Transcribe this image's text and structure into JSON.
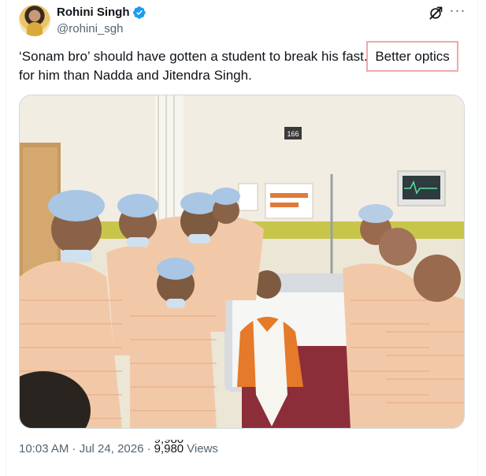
{
  "tweet": {
    "author": {
      "display_name": "Rohini Singh",
      "handle": "@rohini_sgh",
      "verified": true,
      "avatar_icon": "user-avatar"
    },
    "text_part1": "‘Sonam bro’ should have gotten a student to break his fast. ",
    "text_highlighted": "Better optics",
    "text_part2": "for him than Nadda and Jitendra Singh.",
    "highlight_color": "#f0a9a9",
    "image_room_number": "166",
    "timestamp": "10:03 AM · Jul 24, 2026 ·",
    "views_count": "9,980",
    "views_count_previous": "9,980",
    "views_label": "Views"
  },
  "icons": {
    "verified": "verified-badge-icon",
    "grok": "grok-icon",
    "more": "more-options-icon"
  },
  "colors": {
    "verified_blue": "#1d9bf0",
    "text_primary": "#0f1419",
    "text_secondary": "#536471"
  }
}
